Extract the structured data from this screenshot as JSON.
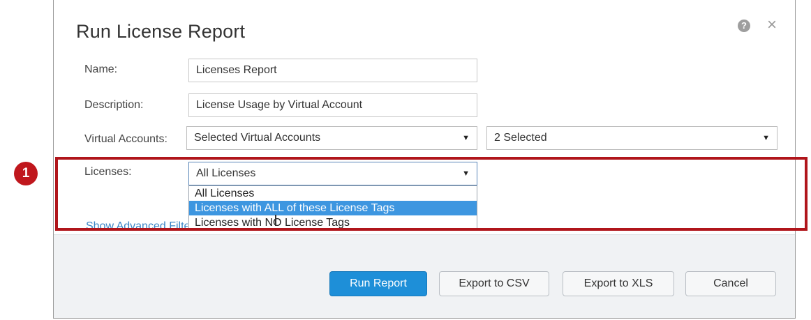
{
  "dialog": {
    "title": "Run License Report",
    "help_icon": "?",
    "close_icon": "×"
  },
  "form": {
    "name": {
      "label": "Name:",
      "value": "Licenses Report"
    },
    "description": {
      "label": "Description:",
      "value": "License Usage by Virtual Account"
    },
    "virtual_accounts": {
      "label": "Virtual Accounts:",
      "selected": "Selected Virtual Accounts",
      "secondary_selected": "2 Selected"
    },
    "licenses": {
      "label": "Licenses:",
      "selected": "All Licenses",
      "options": [
        "All Licenses",
        "Licenses with ALL of these License Tags",
        "Licenses with NO License Tags"
      ],
      "highlighted_index": 1
    },
    "advanced_link": "Show Advanced Filters"
  },
  "buttons": {
    "run_report": "Run Report",
    "export_csv": "Export to CSV",
    "export_xls": "Export to XLS",
    "cancel": "Cancel"
  },
  "annotation": {
    "step_number": "1",
    "color": "#b0151b"
  },
  "colors": {
    "primary_button": "#1e8fd8",
    "highlight_option": "#3d96e0",
    "link": "#3a85c6"
  }
}
